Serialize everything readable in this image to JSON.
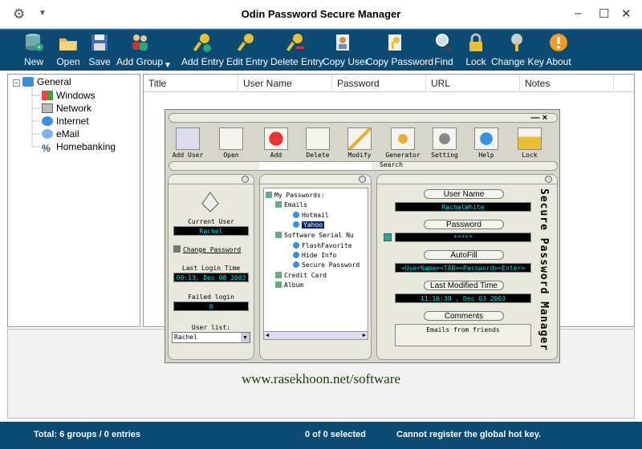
{
  "window": {
    "title": "Odin Password Secure Manager"
  },
  "toolbar": {
    "items": [
      {
        "label": "New",
        "icon": "new-database-icon"
      },
      {
        "label": "Open",
        "icon": "open-folder-icon"
      },
      {
        "label": "Save",
        "icon": "save-disk-icon"
      },
      {
        "label": "Add Group",
        "icon": "add-group-icon"
      },
      {
        "label": "Add Entry",
        "icon": "add-entry-key-icon"
      },
      {
        "label": "Edit Entry",
        "icon": "edit-entry-key-icon"
      },
      {
        "label": "Delete Entry",
        "icon": "delete-entry-key-icon"
      },
      {
        "label": "Copy User",
        "icon": "copy-user-icon"
      },
      {
        "label": "Copy Password",
        "icon": "copy-password-icon"
      },
      {
        "label": "Find",
        "icon": "magnifier-icon"
      },
      {
        "label": "Lock",
        "icon": "padlock-icon"
      },
      {
        "label": "Change Key",
        "icon": "change-key-icon"
      },
      {
        "label": "About",
        "icon": "warning-about-icon"
      }
    ]
  },
  "tree": {
    "root": "General",
    "children": [
      "Windows",
      "Network",
      "Internet",
      "eMail",
      "Homebanking"
    ]
  },
  "grid": {
    "columns": [
      "Title",
      "User Name",
      "Password",
      "URL",
      "Notes"
    ]
  },
  "overlay_text": "www.rasekhoon.net/software",
  "status": {
    "left": "Total: 6 groups / 0 entries",
    "middle": "0 of 0 selected",
    "right": "Cannot register the global hot key."
  },
  "inner": {
    "window_controls": "—  ×",
    "toolbar": [
      "Add User",
      "Open",
      "Add",
      "Delete",
      "Modify",
      "Generator",
      "Setting",
      "Help",
      "Lock"
    ],
    "search_label": "Search",
    "left": {
      "current_user_label": "Current User",
      "current_user": "Rachel",
      "change_password": "Change Password",
      "last_login_label": "Last Login Time",
      "last_login": "09:13, Dec 08 2003",
      "failed_login_label": "Failed login",
      "failed_login": "0",
      "user_list_label": "User list:",
      "user_list_value": "Rachel"
    },
    "tree": {
      "root": "My Passwords:",
      "emails": "Emails",
      "hotmail": "Hotmail",
      "yahoo": "Yahoo",
      "serial": "Software Serial Nu",
      "flash": "FlashFavorite",
      "hideinfo": "Hide Info",
      "securepw": "Secure Password",
      "credit": "Credit Card",
      "album": "Album"
    },
    "right": {
      "user_name_label": "User Name",
      "user_name": "RachelWhite",
      "password_label": "Password",
      "password": "*****",
      "autofill_label": "AutoFill",
      "autofill": "<UserName><TAB><Password><Enter>",
      "modified_label": "Last Modified Time",
      "modified": "11:16:39 , Dec 03 2003",
      "comments_label": "Comments",
      "comments": "Emails from friends",
      "vertical_title": "Secure Password Manager"
    }
  },
  "colors": {
    "toolbar_bg": "#0b4a73",
    "status_bg": "#0b4a73",
    "field_text": "#00e0e8"
  }
}
